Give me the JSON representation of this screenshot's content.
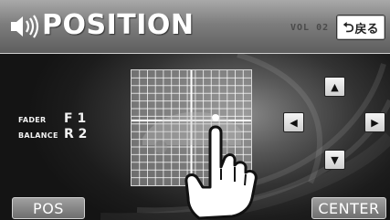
{
  "header": {
    "title": "POSITION",
    "volume_text": "VOL 02",
    "back_arrow": "⮌",
    "back_label": "戻る"
  },
  "settings": {
    "fader_label": "FADER",
    "fader_value": "F 1",
    "balance_label": "BALANCE",
    "balance_value": "R 2"
  },
  "arrows": {
    "up": "▲",
    "down": "▼",
    "left": "◀",
    "right": "▶"
  },
  "footer": {
    "pos_label": "POS",
    "center_label": "CENTER"
  },
  "colors": {
    "header_bg": "#8a8a8a",
    "text": "#ffffff",
    "button_face": "#e8e8e8"
  }
}
